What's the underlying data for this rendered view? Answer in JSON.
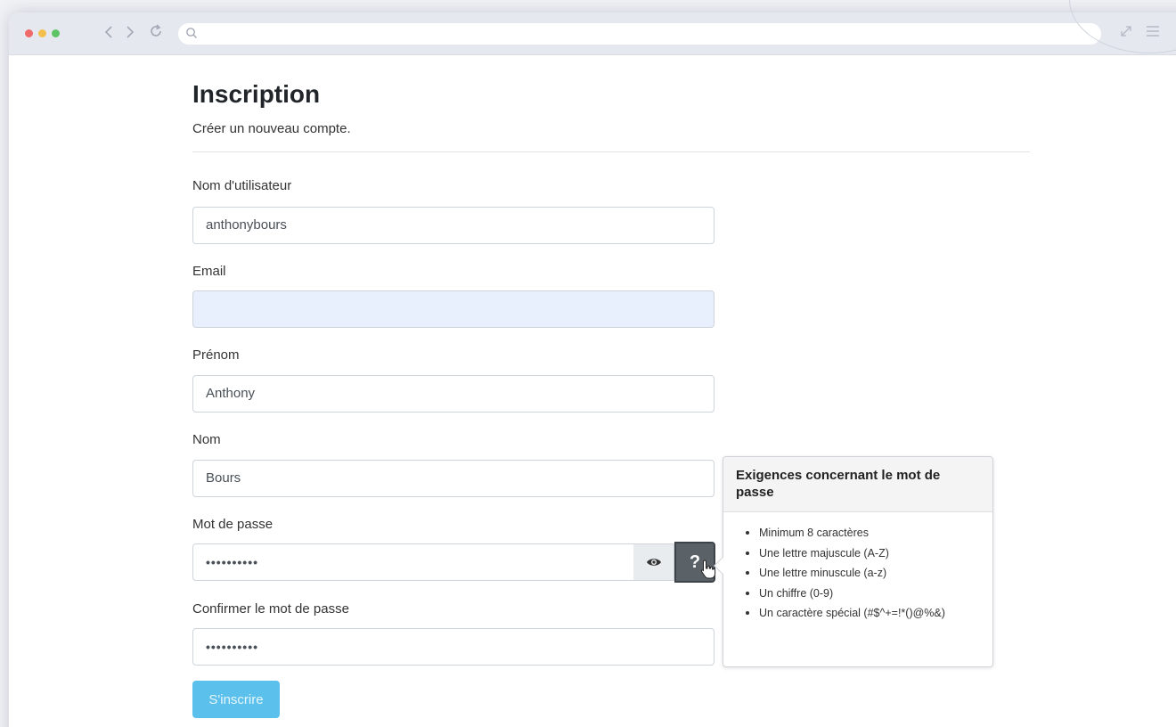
{
  "page": {
    "title": "Inscription",
    "subtitle": "Créer un nouveau compte."
  },
  "form": {
    "username": {
      "label": "Nom d'utilisateur",
      "value": "anthonybours"
    },
    "email": {
      "label": "Email",
      "value": ""
    },
    "firstname": {
      "label": "Prénom",
      "value": "Anthony"
    },
    "lastname": {
      "label": "Nom",
      "value": "Bours"
    },
    "password": {
      "label": "Mot de passe",
      "value": "••••••••••",
      "help_label": "?"
    },
    "confirm": {
      "label": "Confirmer le mot de passe",
      "value": "••••••••••"
    },
    "submit_label": "S'inscrire"
  },
  "popover": {
    "title": "Exigences concernant le mot de passe",
    "items": [
      "Minimum 8 caractères",
      "Une lettre majuscule (A-Z)",
      "Une lettre minuscule (a-z)",
      "Un chiffre (0-9)",
      "Un caractère spécial (#$^+=!*()@%&)"
    ]
  },
  "browser": {
    "icons": [
      "back-icon",
      "forward-icon",
      "reload-icon",
      "search-icon",
      "expand-icon",
      "menu-icon"
    ]
  },
  "colors": {
    "submit": "#5bc0eb",
    "help_button": "#5a6268",
    "autofill": "#e8f0fe"
  }
}
